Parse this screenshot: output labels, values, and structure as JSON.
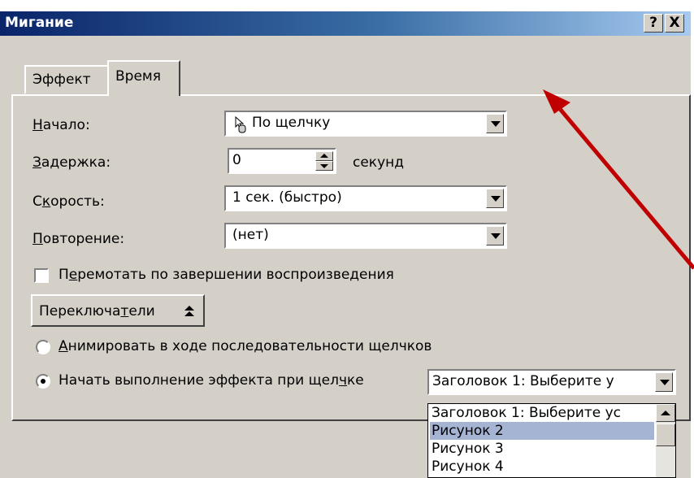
{
  "window": {
    "title": "Мигание"
  },
  "title_buttons": {
    "help": "?",
    "close": "X"
  },
  "tabs": [
    {
      "label": "Эффект"
    },
    {
      "label": "Время"
    }
  ],
  "form": {
    "start": {
      "label_u": "Н",
      "label_rest": "ачало:",
      "value": "По щелчку"
    },
    "delay": {
      "label_u": "З",
      "label_rest": "адержка:",
      "value": "0",
      "unit": "секунд"
    },
    "speed": {
      "label_pre": "С",
      "label_u": "к",
      "label_rest": "орость:",
      "value": "1 сек. (быстро)"
    },
    "repeat": {
      "label_u": "П",
      "label_rest": "овторение:",
      "value": "(нет)"
    },
    "rewind": {
      "pre": "П",
      "u": "е",
      "rest": "ремотать по завершении воспроизведения",
      "checked": false
    }
  },
  "triggers": {
    "button_pre": "Переключа",
    "button_u": "т",
    "button_rest": "ели",
    "button_icon": "double-chevron-up-icon",
    "animate_radio": {
      "u": "А",
      "rest": "нимировать в ходе последовательности щелчков",
      "selected": false
    },
    "start_radio": {
      "pre": "Начать выполнение эффекта при щел",
      "u": "ч",
      "rest": "ке",
      "selected": true
    },
    "trigger_value": "Заголовок 1: Выберите у"
  },
  "trigger_list": [
    {
      "label": "Заголовок 1: Выберите ус"
    },
    {
      "label": "Рисунок 2"
    },
    {
      "label": "Рисунок 3"
    },
    {
      "label": "Рисунок 4"
    }
  ],
  "annotation": {
    "color": "#c00000",
    "icon": "red-arrow-icon"
  },
  "colors": {
    "titlebar_start": "#0a246a",
    "titlebar_end": "#a6caf0",
    "face": "#d4d0c8",
    "selection": "#a6b4d4"
  }
}
